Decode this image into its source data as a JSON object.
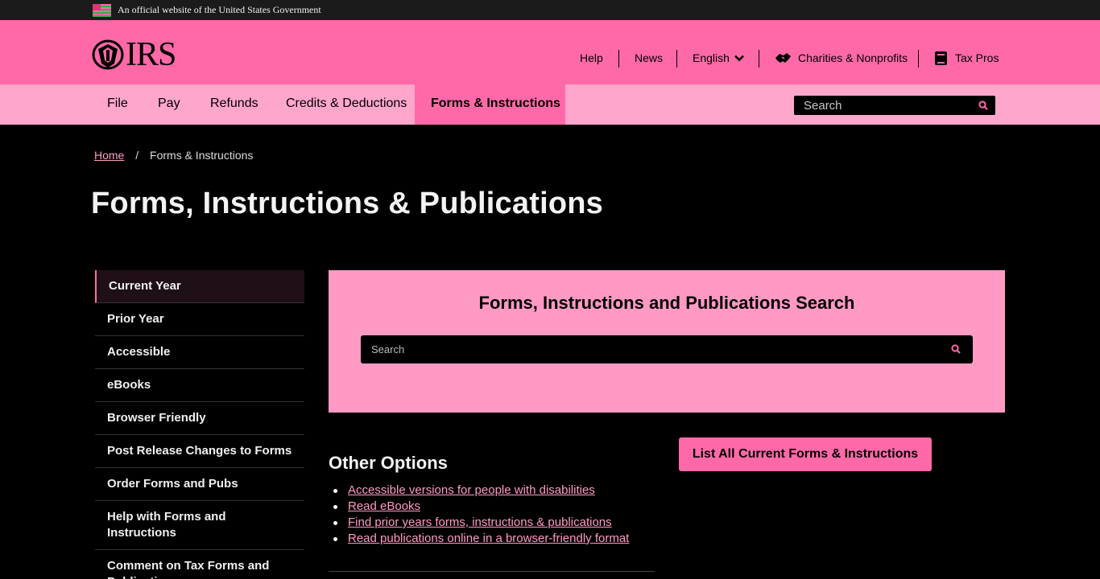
{
  "gov_banner": {
    "text": "An official website of the United States Government",
    "flag_icon": "us-flag-icon"
  },
  "header": {
    "logo_text": "IRS",
    "logo_icon": "irs-eagle-icon",
    "links": {
      "help": "Help",
      "news": "News",
      "language": "English",
      "charities": "Charities & Nonprofits",
      "tax_pros": "Tax Pros"
    }
  },
  "main_nav": {
    "items": [
      "File",
      "Pay",
      "Refunds",
      "Credits & Deductions",
      "Forms & Instructions"
    ],
    "active_index": 4,
    "search_placeholder": "Search"
  },
  "breadcrumb": {
    "home": "Home",
    "separator": "/",
    "current": "Forms & Instructions"
  },
  "page_title": "Forms, Instructions & Publications",
  "sidebar": {
    "items": [
      "Current Year",
      "Prior Year",
      "Accessible",
      "eBooks",
      "Browser Friendly",
      "Post Release Changes to Forms",
      "Order Forms and Pubs",
      "Help with Forms and Instructions",
      "Comment on Tax Forms and Publications"
    ],
    "active_index": 0
  },
  "search_panel": {
    "title": "Forms, Instructions and Publications Search",
    "placeholder": "Search"
  },
  "other_options": {
    "title": "Other Options",
    "links": [
      "Accessible versions for people with disabilities",
      "Read eBooks",
      "Find prior years forms, instructions & publications",
      "Read publications online in a browser-friendly format"
    ]
  },
  "list_all_button": "List All Current Forms & Instructions",
  "colors": {
    "accent_pink": "#ff69a8",
    "light_pink": "#ffa6cc",
    "panel_pink": "#ff9ac4",
    "background": "#000000"
  }
}
